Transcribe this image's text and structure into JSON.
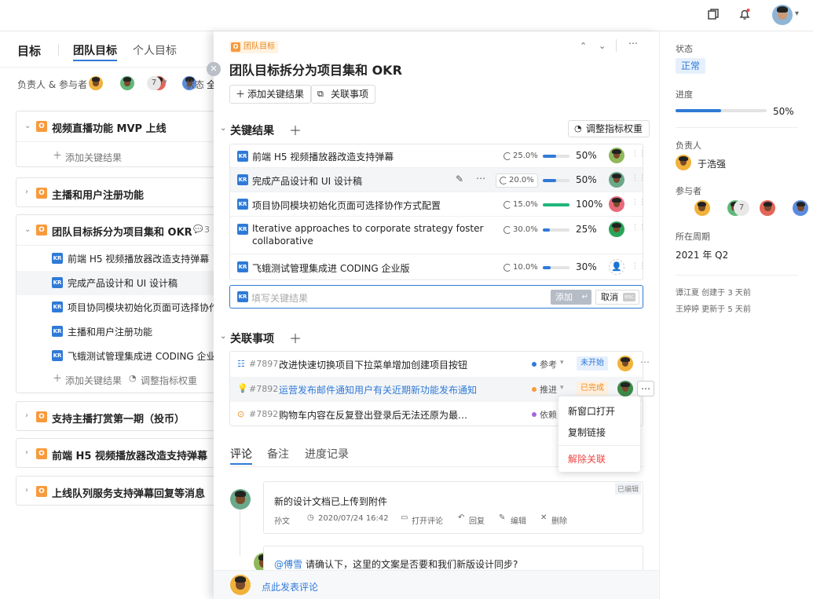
{
  "topbar": {
    "icons": [
      "copy-icon",
      "bell-icon",
      "user-avatar"
    ]
  },
  "left": {
    "title": "目标",
    "tabs": [
      "团队目标",
      "个人目标"
    ],
    "filter_label": "负责人 & 参与者",
    "filter_count": "7",
    "status_label": "状态",
    "status_value": "全",
    "objectives": [
      {
        "title": "视频直播功能 MVP 上线",
        "badge": "O",
        "add_kr": "添加关键结果"
      },
      {
        "title": "主播和用户注册功能",
        "badge": "O"
      },
      {
        "title": "团队目标拆分为项目集和 OKR",
        "badge": "O",
        "comment_count": "3",
        "krs": [
          "前端 H5 视频播放器改造支持弹幕",
          "完成产品设计和 UI 设计稿",
          "项目协同模块初始化页面可选择协作",
          "主播和用户注册功能",
          "飞蛾测试管理集成进 CODING 企业版"
        ],
        "add_kr": "添加关键结果",
        "adjust": "调整指标权重"
      },
      {
        "title": "支持主播打赏第一期（投币）",
        "badge": "O"
      },
      {
        "title": "前端 H5 视频播放器改造支持弹幕",
        "badge": "O"
      },
      {
        "title": "上线队列服务支持弹幕回复等消息",
        "badge": "O"
      }
    ],
    "kr_badge": "KR"
  },
  "detail": {
    "breadcrumb": "团队目标",
    "title": "团队目标拆分为项目集和 OKR",
    "add_kr_button": "添加关键结果",
    "link_button": "关联事项",
    "kr_section": "关键结果",
    "adjust_button": "调整指标权重",
    "krs": [
      {
        "title": "前端 H5 视频播放器改造支持弹幕",
        "weight": "25.0%",
        "progress": 0.5,
        "pct": "50%"
      },
      {
        "title": "完成产品设计和 UI 设计稿",
        "weight": "20.0%",
        "progress": 0.5,
        "pct": "50%"
      },
      {
        "title": "项目协同模块初始化页面可选择协作方式配置",
        "weight": "15.0%",
        "progress": 1.0,
        "pct": "100%"
      },
      {
        "title": "Iterative approaches to corporate strategy foster",
        "title2": "collaborative",
        "weight": "30.0%",
        "progress": 0.25,
        "pct": "25%"
      },
      {
        "title": "飞蛾测试管理集成进 CODING 企业版",
        "weight": "10.0%",
        "progress": 0.3,
        "pct": "30%"
      }
    ],
    "input_placeholder": "填写关键结果",
    "add_label": "添加",
    "cancel_label": "取消",
    "esc_label": "esc",
    "related_section": "关联事项",
    "related": [
      {
        "id": "#7897",
        "title": "改进快速切换项目下拉菜单增加创建项目按钮",
        "type": "参考",
        "status": "未开始"
      },
      {
        "id": "#7892",
        "title": "运营发布邮件通知用户有关近期新功能发布通知",
        "type": "推进",
        "status": "已完成"
      },
      {
        "id": "#7892",
        "title": "购物车内容在反复登出登录后无法还原为最…",
        "type": "依赖",
        "status": ""
      }
    ],
    "menu": [
      "新窗口打开",
      "复制链接",
      "解除关联"
    ],
    "tabs": [
      "评论",
      "备注",
      "进度记录"
    ],
    "comments": [
      {
        "text": "新的设计文档已上传到附件",
        "author": "孙文",
        "time": "2020/07/24 16:42",
        "edited": "已编辑",
        "actions": [
          "打开评论",
          "回复",
          "编辑",
          "删除"
        ]
      },
      {
        "mention": "@傅雪",
        "text": "请确认下，这里的文案是否要和我们新版设计同步?"
      }
    ],
    "post_comment": "点此发表评论"
  },
  "right": {
    "status_label": "状态",
    "status": "正常",
    "progress_label": "进度",
    "progress": 0.5,
    "progress_pct": "50%",
    "owner_label": "负责人",
    "owner": "于浩强",
    "participants_label": "参与者",
    "participants_more": "7",
    "period_label": "所在周期",
    "period": "2021 年 Q2",
    "created": "谭江夏 创建于 3 天前",
    "updated": "王婷婷 更新于 5 天前"
  },
  "colors": {
    "accent": "#2f7ad8",
    "orange": "#f89a3c",
    "green": "#1fb77a",
    "red": "#e44"
  }
}
